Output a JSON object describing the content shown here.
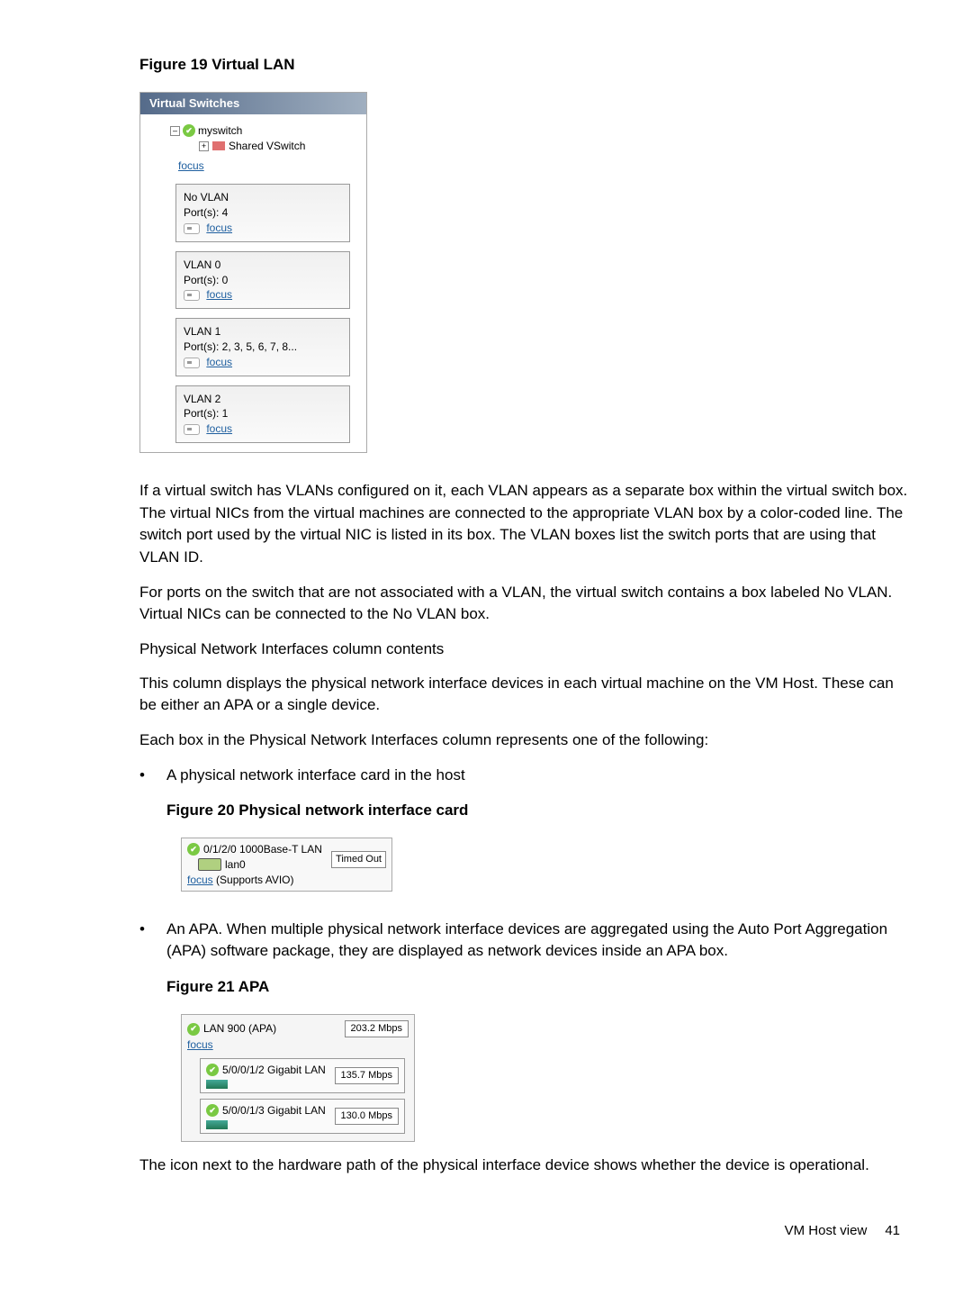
{
  "figure19": {
    "title": "Figure 19 Virtual LAN"
  },
  "vswitch": {
    "header": "Virtual Switches",
    "switch_name": "myswitch",
    "shared_label": "Shared VSwitch",
    "focus": "focus",
    "vlans": [
      {
        "title": "No VLAN",
        "ports": "Port(s): 4",
        "focus": "focus"
      },
      {
        "title": "VLAN 0",
        "ports": "Port(s): 0",
        "focus": "focus"
      },
      {
        "title": "VLAN 1",
        "ports": "Port(s): 2, 3, 5, 6, 7, 8...",
        "focus": "focus"
      },
      {
        "title": "VLAN 2",
        "ports": "Port(s): 1",
        "focus": "focus"
      }
    ]
  },
  "para1": "If a virtual switch has VLANs configured on it, each VLAN appears as a separate box within the virtual switch box. The virtual NICs from the virtual machines are connected to the appropriate VLAN box by a color-coded line. The switch port used by the virtual NIC is listed in its box. The VLAN boxes list the switch ports that are using that VLAN ID.",
  "para2": "For ports on the switch that are not associated with a VLAN, the virtual switch contains a box labeled No VLAN. Virtual NICs can be connected to the No VLAN box.",
  "section_head": "Physical Network Interfaces column contents",
  "para3": "This column displays the physical network interface devices in each virtual machine on the VM Host. These can be either an APA or a single device.",
  "para4": "Each box in the Physical Network Interfaces column represents one of the following:",
  "bullet1": "A physical network interface card in the host",
  "figure20": {
    "title": "Figure 20 Physical network interface card"
  },
  "nic": {
    "hwpath": "0/1/2/0 1000Base-T LAN",
    "lan": "lan0",
    "timed_out": "Timed Out",
    "focus": "focus",
    "supports": " (Supports AVIO)"
  },
  "bullet2": "An APA. When multiple physical network interface devices are aggregated using the Auto Port Aggregation (APA) software package, they are displayed as network devices inside an APA box.",
  "figure21": {
    "title": "Figure 21 APA"
  },
  "apa": {
    "top_label": "LAN 900 (APA)",
    "focus": "focus",
    "top_mbps": "203.2 Mbps",
    "sub": [
      {
        "label": "5/0/0/1/2 Gigabit LAN",
        "mbps": "135.7 Mbps"
      },
      {
        "label": "5/0/0/1/3 Gigabit LAN",
        "mbps": "130.0 Mbps"
      }
    ]
  },
  "para5": "The icon next to the hardware path of the physical interface device shows whether the device is operational.",
  "footer": {
    "label": "VM Host view",
    "page": "41"
  }
}
